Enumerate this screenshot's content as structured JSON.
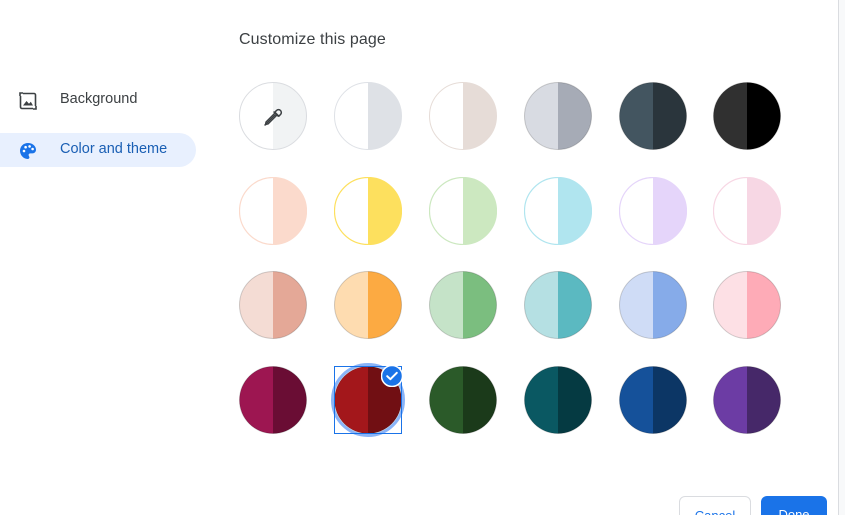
{
  "page": {
    "title": "Customize this page"
  },
  "nav": {
    "items": [
      {
        "label": "Background",
        "icon": "image-icon",
        "selected": false
      },
      {
        "label": "Color and theme",
        "icon": "palette-icon",
        "selected": true
      }
    ]
  },
  "swatches": [
    [
      {
        "name": "swatch-custom-color",
        "left": "#ffffff",
        "right": "#f1f3f4",
        "icon": "eyedropper-icon",
        "selected": false
      },
      {
        "name": "swatch-light-grey",
        "left": "#ffffff",
        "right": "#dee1e6",
        "selected": false
      },
      {
        "name": "swatch-warm-grey",
        "left": "#ffffff",
        "right": "#e6dcd7",
        "selected": false
      },
      {
        "name": "swatch-cool-grey",
        "left": "#d8dbe2",
        "right": "#a6abb6",
        "selected": false
      },
      {
        "name": "swatch-slate",
        "left": "#435560",
        "right": "#2a353c",
        "selected": false
      },
      {
        "name": "swatch-black",
        "left": "#303030",
        "right": "#000000",
        "selected": false
      }
    ],
    [
      {
        "name": "swatch-peach-light",
        "left": "#ffffff",
        "right": "#fbdacc",
        "selected": false
      },
      {
        "name": "swatch-yellow-light",
        "left": "#ffffff",
        "right": "#fde05e",
        "selected": false
      },
      {
        "name": "swatch-green-light",
        "left": "#ffffff",
        "right": "#cce8c0",
        "selected": false
      },
      {
        "name": "swatch-aqua-light",
        "left": "#ffffff",
        "right": "#b0e5ef",
        "selected": false
      },
      {
        "name": "swatch-lavender-light",
        "left": "#ffffff",
        "right": "#e5d5fa",
        "selected": false
      },
      {
        "name": "swatch-pink-light",
        "left": "#ffffff",
        "right": "#f7d7e4",
        "selected": false
      }
    ],
    [
      {
        "name": "swatch-rose",
        "left": "#f4dcd4",
        "right": "#e4a897",
        "selected": false
      },
      {
        "name": "swatch-orange",
        "left": "#fedcb0",
        "right": "#fcaa42",
        "selected": false
      },
      {
        "name": "swatch-green",
        "left": "#c5e3c8",
        "right": "#7bbe7f",
        "selected": false
      },
      {
        "name": "swatch-teal",
        "left": "#b5e0e3",
        "right": "#5bb9c1",
        "selected": false
      },
      {
        "name": "swatch-blue",
        "left": "#cfdcf6",
        "right": "#86abe9",
        "selected": false
      },
      {
        "name": "swatch-pink",
        "left": "#fde0e5",
        "right": "#feabb7",
        "selected": false
      }
    ],
    [
      {
        "name": "swatch-magenta",
        "left": "#9d1651",
        "right": "#6a0d34",
        "selected": false
      },
      {
        "name": "swatch-red",
        "left": "#a3171b",
        "right": "#710f13",
        "selected": true
      },
      {
        "name": "swatch-forest",
        "left": "#2b5a29",
        "right": "#1b3a1a",
        "selected": false
      },
      {
        "name": "swatch-deep-teal",
        "left": "#0a5862",
        "right": "#053a42",
        "selected": false
      },
      {
        "name": "swatch-navy",
        "left": "#15519a",
        "right": "#0c3665",
        "selected": false
      },
      {
        "name": "swatch-purple",
        "left": "#6c3ca4",
        "right": "#462869",
        "selected": false
      }
    ]
  ],
  "actions": {
    "cancel_label": "Cancel",
    "done_label": "Done"
  },
  "colors": {
    "accent": "#1a73e8",
    "selected_nav_bg": "#e8f0fe",
    "text": "#3c4043"
  }
}
